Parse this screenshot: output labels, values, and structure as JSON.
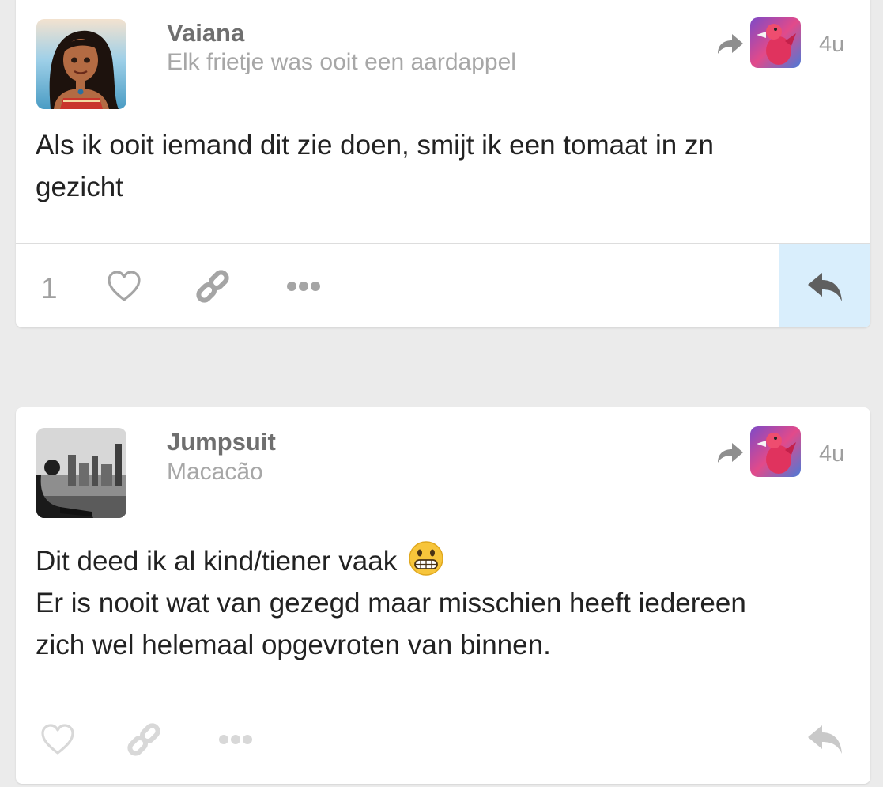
{
  "posts": [
    {
      "username": "Vaiana",
      "category": "Elk frietje was ooit een aardappel",
      "time": "4u",
      "body_lines": [
        "Als ik ooit iemand dit zie doen, smijt ik een tomaat in zn",
        "gezicht"
      ],
      "likes": "1",
      "reply_active": true,
      "icons": {
        "avatar": "vaiana-avatar",
        "share": "share-arrow-icon",
        "group": "flamingo-group-avatar",
        "like": "heart-icon",
        "link": "link-icon",
        "more": "more-dots-icon",
        "reply": "reply-icon"
      }
    },
    {
      "username": "Jumpsuit",
      "category": "Macacão",
      "time": "4u",
      "body_lines": [
        "Dit deed ik al kind/tiener vaak",
        "Er is nooit wat van gezegd maar misschien heeft iedereen",
        "zich wel helemaal opgevroten van binnen."
      ],
      "emoji": "grimacing-face-emoji",
      "likes": "",
      "reply_active": false,
      "icons": {
        "avatar": "city-photo-avatar",
        "share": "share-arrow-icon",
        "group": "flamingo-group-avatar",
        "like": "heart-icon",
        "link": "link-icon",
        "more": "more-dots-icon",
        "reply": "reply-icon"
      }
    }
  ],
  "colors": {
    "background": "#ebebeb",
    "card": "#ffffff",
    "username": "#6f6f6f",
    "category": "#a7a7a7",
    "body": "#222222",
    "icon_dark": "#a5a5a5",
    "icon_light": "#d8d8d8",
    "reply_highlight": "#d9eefc",
    "reply_active_icon": "#5f5f5f"
  }
}
